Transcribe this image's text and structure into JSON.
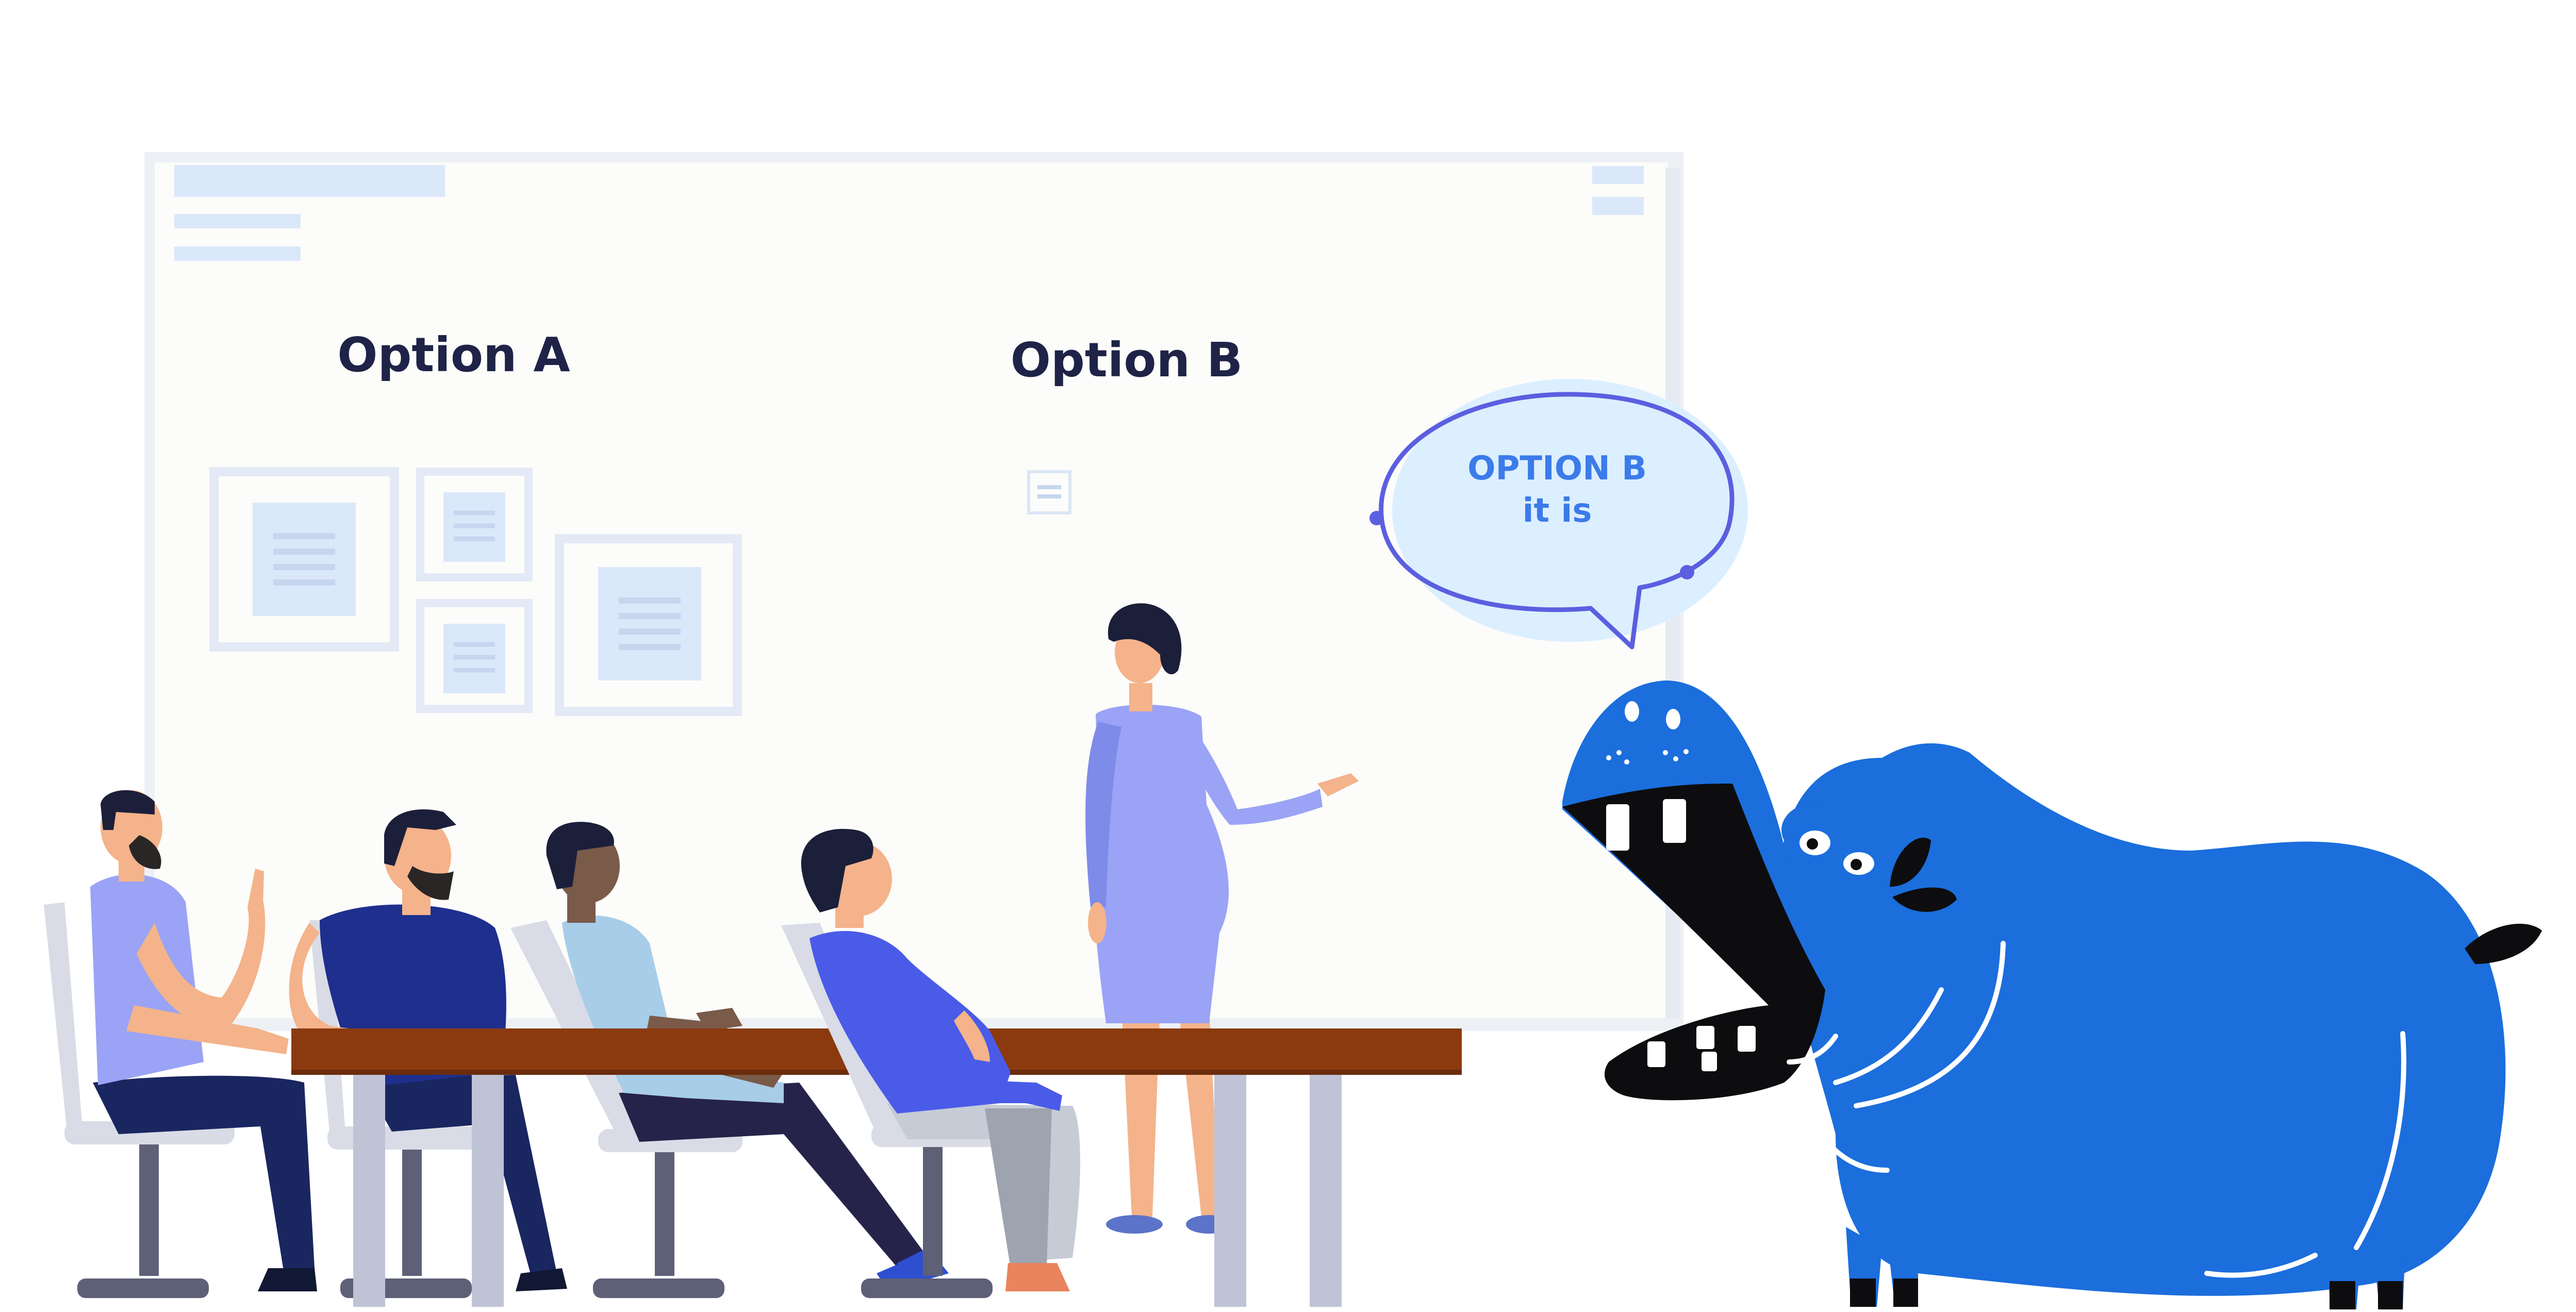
{
  "board": {
    "option_a": "Option A",
    "option_b": "Option B"
  },
  "speech_bubble": {
    "line1": "OPTION B",
    "line2": "it is"
  },
  "colors": {
    "board_fill": "#fcfcfa",
    "board_frame": "#edf1f6",
    "placeholder": "#dbe8fa",
    "label_dark": "#1e2347",
    "bubble_fill": "#dcefff",
    "bubble_stroke": "#5b5fe0",
    "bubble_text": "#3b7bea",
    "table_top": "#8b3a10",
    "table_leg": "#bfc3d6",
    "chair": "#d9dce6",
    "chair_base": "#5e6077",
    "hippo_blue": "#1b6edc",
    "hippo_mouth": "#0d0d0f",
    "skin": "#f4b38a",
    "presenter_dress": "#9aa3f5",
    "navy": "#1a2660"
  }
}
